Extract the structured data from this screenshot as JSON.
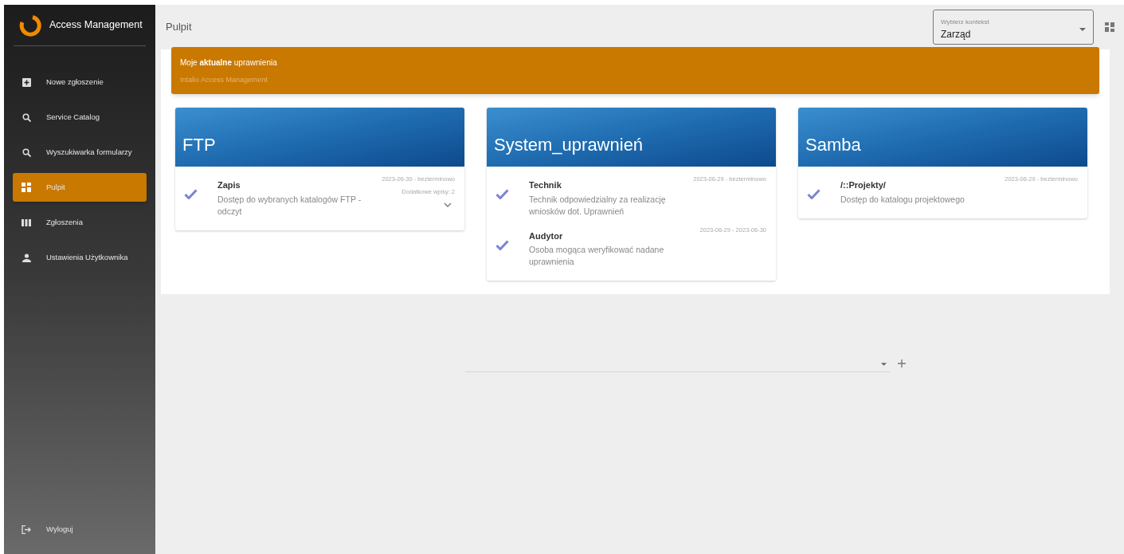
{
  "sidebar": {
    "app_title": "Access Management",
    "items": [
      {
        "label": "Nowe zgłoszenie",
        "selected": false
      },
      {
        "label": "Service Catalog",
        "selected": false
      },
      {
        "label": "Wyszukiwarka formularzy",
        "selected": false
      },
      {
        "label": "Pulpit",
        "selected": true
      },
      {
        "label": "Zgłoszenia",
        "selected": false
      },
      {
        "label": "Ustawienia Użytkownika",
        "selected": false
      }
    ],
    "logout": "Wyloguj"
  },
  "header": {
    "page_title": "Pulpit",
    "context_select": {
      "label": "Wybierz kontekst",
      "value": "Zarząd"
    }
  },
  "widget": {
    "title": "Moje **aktualne** uprawnienia",
    "subtitle": "Intalio Access Management",
    "cards": [
      {
        "title": "FTP",
        "entries": [
          {
            "name": "Zapis",
            "description": "Dostęp do wybranych katalogów FTP - odczyt",
            "dates": "2023-06-30 - bezterminowo",
            "extra": "Dodatkowe wpisy: 2",
            "expandable": true
          }
        ]
      },
      {
        "title": "System_uprawnień",
        "entries": [
          {
            "name": "Technik",
            "description": "Technik odpowiedzialny za realizację wniosków dot. Uprawnień",
            "dates": "2023-06-29 - bezterminowo",
            "expandable": false
          },
          {
            "name": "Audytor",
            "description": "Osoba mogąca weryfikować nadane uprawnienia",
            "dates": "2023-06-29 - 2023-06-30",
            "expandable": false
          }
        ]
      },
      {
        "title": "Samba",
        "entries": [
          {
            "name": "/::Projekty/",
            "description": "Dostęp do katalogu projektowego",
            "dates": "2023-06-29 - bezterminowo",
            "expandable": false
          }
        ]
      }
    ]
  }
}
